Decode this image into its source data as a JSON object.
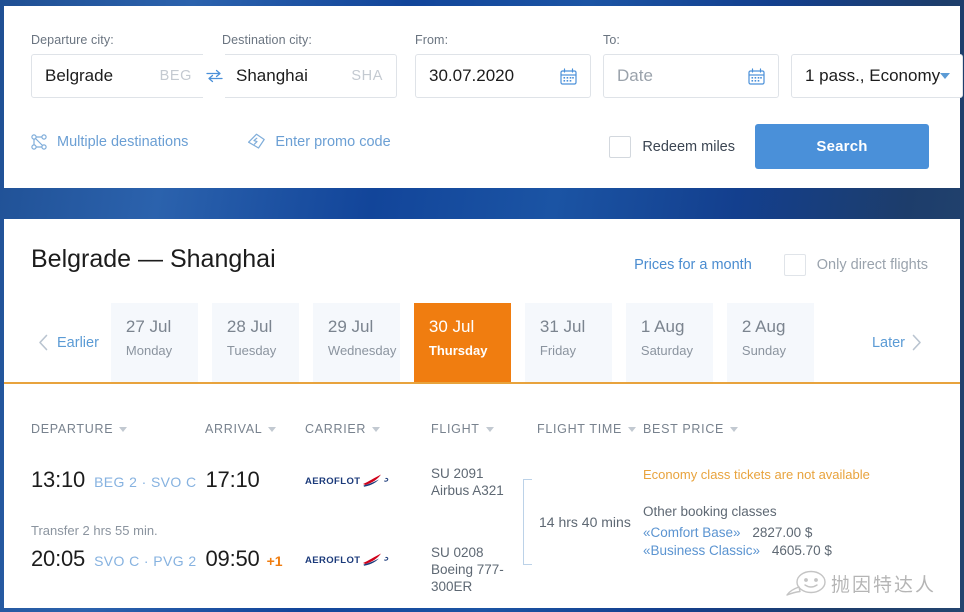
{
  "search": {
    "departure_label": "Departure city:",
    "departure_value": "Belgrade",
    "departure_code": "BEG",
    "destination_label": "Destination city:",
    "destination_value": "Shanghai",
    "destination_code": "SHA",
    "from_label": "From:",
    "from_value": "30.07.2020",
    "to_label": "To:",
    "to_placeholder": "Date",
    "passengers_value": "1 pass., Economy",
    "multiple_destinations": "Multiple destinations",
    "promo_code": "Enter promo code",
    "redeem_miles": "Redeem miles",
    "search_button": "Search"
  },
  "results": {
    "route_title": "Belgrade — Shanghai",
    "prices_month_link": "Prices for a month",
    "only_direct_label": "Only direct flights",
    "earlier": "Earlier",
    "later": "Later",
    "dates": [
      {
        "day": "27 Jul",
        "weekday": "Monday",
        "active": false
      },
      {
        "day": "28 Jul",
        "weekday": "Tuesday",
        "active": false
      },
      {
        "day": "29 Jul",
        "weekday": "Wednesday",
        "active": false
      },
      {
        "day": "30 Jul",
        "weekday": "Thursday",
        "active": true
      },
      {
        "day": "31 Jul",
        "weekday": "Friday",
        "active": false
      },
      {
        "day": "1 Aug",
        "weekday": "Saturday",
        "active": false
      },
      {
        "day": "2 Aug",
        "weekday": "Sunday",
        "active": false
      }
    ],
    "columns": {
      "departure": "DEPARTURE",
      "arrival": "ARRIVAL",
      "carrier": "CARRIER",
      "flight": "FLIGHT",
      "flight_time": "FLIGHT TIME",
      "best_price": "BEST PRICE"
    },
    "itinerary": {
      "legs": [
        {
          "depart_time": "13:10",
          "codes": "BEG 2 · SVO C",
          "arrive_time": "17:10",
          "next_day": "",
          "carrier": "AEROFLOT",
          "flight_number": "SU 2091",
          "aircraft": "Airbus A321"
        },
        {
          "depart_time": "20:05",
          "codes": "SVO C · PVG 2",
          "arrive_time": "09:50",
          "next_day": "+1",
          "carrier": "AEROFLOT",
          "flight_number": "SU 0208",
          "aircraft": "Boeing 777-300ER"
        }
      ],
      "transfer_note": "Transfer 2 hrs 55 min.",
      "total_duration": "14 hrs 40 mins",
      "availability_notice": "Economy class tickets are not available",
      "other_classes_label": "Other booking classes",
      "fares": [
        {
          "name": "«Comfort Base»",
          "price": "2827.00 $"
        },
        {
          "name": "«Business Classic»",
          "price": "4605.70 $"
        }
      ]
    }
  },
  "watermark": {
    "text": "抛因特达人"
  },
  "colors": {
    "accent_blue": "#4a90d9",
    "accent_orange": "#f07d10",
    "link_blue": "#5b94d1",
    "notice_orange": "#e8a33d"
  }
}
